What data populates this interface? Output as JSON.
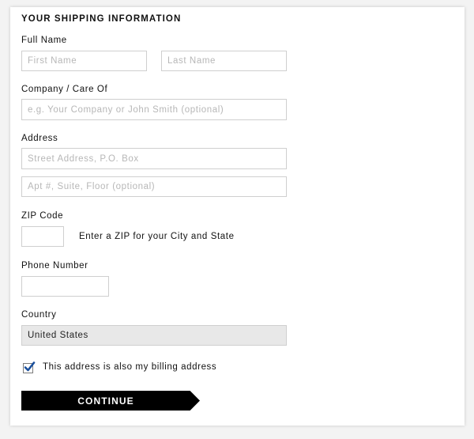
{
  "form": {
    "title": "YOUR SHIPPING INFORMATION",
    "full_name_label": "Full Name",
    "first_name_placeholder": "First Name",
    "last_name_placeholder": "Last Name",
    "company_label": "Company / Care Of",
    "company_placeholder": "e.g. Your Company or John Smith (optional)",
    "address_label": "Address",
    "street_placeholder": "Street Address, P.O. Box",
    "apt_placeholder": "Apt #, Suite, Floor (optional)",
    "zip_label": "ZIP Code",
    "zip_hint": "Enter a ZIP for your City and State",
    "phone_label": "Phone Number",
    "country_label": "Country",
    "country_value": "United States",
    "billing_label": "This address is also my billing address",
    "billing_checked": true,
    "continue_label": "CONTINUE"
  },
  "colors": {
    "accent": "#1a4f9c",
    "button_bg": "#000000",
    "input_border": "#cfcfcf",
    "select_bg": "#e8e8e8"
  }
}
